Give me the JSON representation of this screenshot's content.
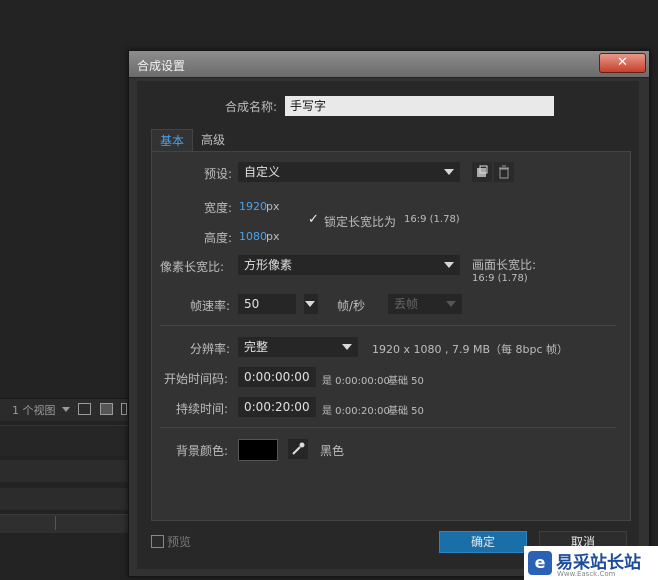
{
  "background_app": {
    "view_label": "1 个视图"
  },
  "dialog": {
    "title": "合成设置",
    "close_glyph": "✕",
    "name_label": "合成名称:",
    "name_value": "手写字",
    "tabs": [
      {
        "label": "基本",
        "active": true
      },
      {
        "label": "高级",
        "active": false
      }
    ],
    "preset": {
      "label": "预设:",
      "value": "自定义"
    },
    "width": {
      "label": "宽度:",
      "value": "1920",
      "unit": "px"
    },
    "height": {
      "label": "高度:",
      "value": "1080",
      "unit": "px"
    },
    "lock_aspect": {
      "checked": true,
      "label": "锁定长宽比为",
      "ratio": "16:9 (1.78)"
    },
    "pixel_aspect": {
      "label": "像素长宽比:",
      "value": "方形像素"
    },
    "frame_aspect": {
      "label": "画面长宽比:",
      "value": "16:9 (1.78)"
    },
    "frame_rate": {
      "label": "帧速率:",
      "value": "50",
      "unit": "帧/秒",
      "drop_frame": "丢帧"
    },
    "resolution": {
      "label": "分辨率:",
      "value": "完整",
      "info": "1920 x 1080 , 7.9 MB（每 8bpc 帧）"
    },
    "start_timecode": {
      "label": "开始时间码:",
      "value": "0:00:00:00",
      "is_label": "是 0:00:00:00",
      "base_label": "基础 50"
    },
    "duration": {
      "label": "持续时间:",
      "value": "0:00:20:00",
      "is_label": "是 0:00:20:00",
      "base_label": "基础 50"
    },
    "background_color": {
      "label": "背景颜色:",
      "color": "#000000",
      "name": "黑色"
    },
    "preview_label": "预览",
    "ok_label": "确定",
    "cancel_label": "取消"
  },
  "watermark": {
    "icon_glyph": "e",
    "text": "易采站长站",
    "sub": "Www.Easck.Com"
  }
}
